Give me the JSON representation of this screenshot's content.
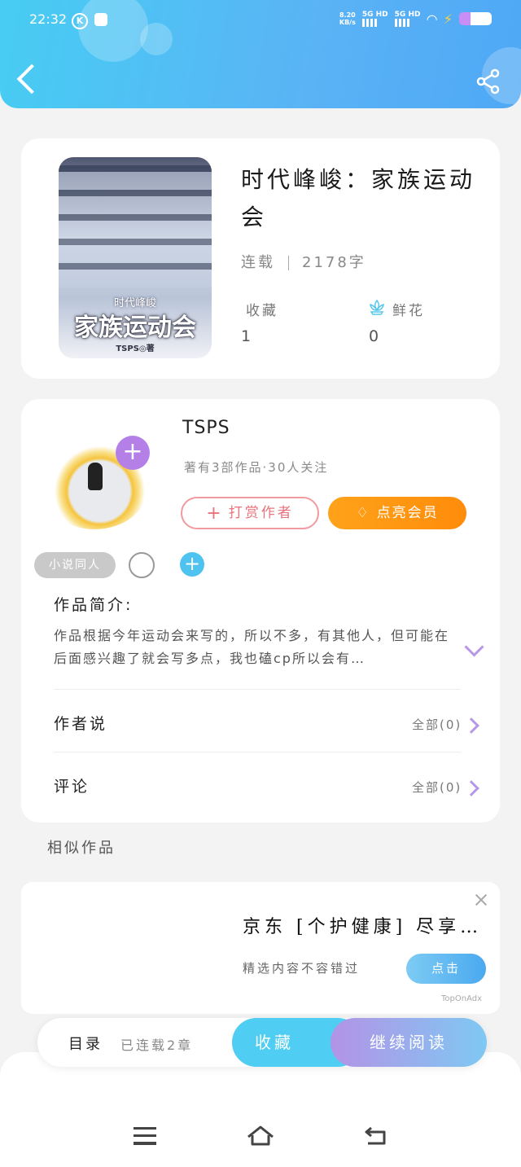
{
  "status_bar": {
    "time": "22:32",
    "net_speed": "8.20",
    "net_unit": "KB/s",
    "signal1": "5G HD",
    "signal2": "5G HD",
    "app_k": "K"
  },
  "header": {
    "back_icon": "back-arrow-icon",
    "share_icon": "share-icon"
  },
  "book": {
    "cover_series": "时代峰峻",
    "cover_title": "家族运动会",
    "cover_author": "TSPS◎著",
    "title": "时代峰峻：家族运动会",
    "status": "连载",
    "word_count": "2178字",
    "favorites_label": "收藏",
    "favorites_value": "1",
    "flowers_label": "鲜花",
    "flowers_value": "0"
  },
  "author": {
    "name": "TSPS",
    "meta": "著有3部作品·30人关注",
    "tip_button": "打赏作者",
    "vip_button": "点亮会员",
    "tag": "小说同人"
  },
  "intro": {
    "label": "作品简介:",
    "text": "作品根据今年运动会来写的，所以不多，有其他人，但可能在后面感兴趣了就会写多点，我也磕cp所以会有…"
  },
  "author_says": {
    "label": "作者说",
    "all": "全部(0)"
  },
  "comments": {
    "label": "评论",
    "all": "全部(0)"
  },
  "similar_label": "相似作品",
  "ad": {
    "title": "京东 [个护健康] 尽享…",
    "subtitle": "精选内容不容错过",
    "button": "点击",
    "mark": "TopOnAdx"
  },
  "bottom": {
    "toc": "目录",
    "chapters": "已连载2章",
    "favorite": "收藏",
    "continue": "继续阅读"
  },
  "colors": {
    "header_blue": "#47cdf3",
    "accent_purple": "#b57fe8",
    "vip_orange": "#ffa21a",
    "tip_pink": "#e9727c"
  }
}
